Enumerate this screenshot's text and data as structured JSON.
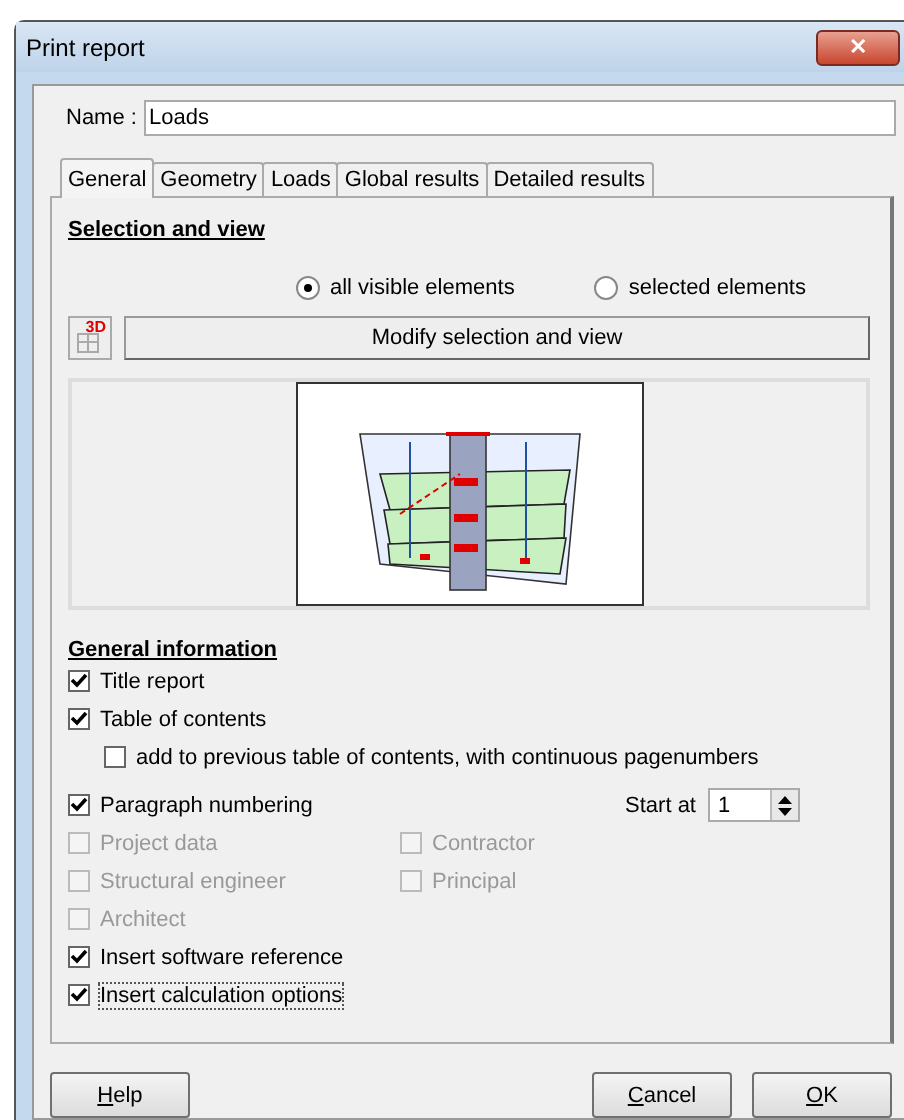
{
  "window": {
    "title": "Print report",
    "close": "✕"
  },
  "name_field": {
    "label": "Name :",
    "value": "Loads"
  },
  "tabs": [
    {
      "label": "General",
      "selected": true
    },
    {
      "label": "Geometry",
      "selected": false
    },
    {
      "label": "Loads",
      "selected": false
    },
    {
      "label": "Global results",
      "selected": false
    },
    {
      "label": "Detailed results",
      "selected": false
    }
  ],
  "selection": {
    "heading": "Selection and view",
    "radios": [
      {
        "label": "all visible elements",
        "selected": true
      },
      {
        "label": "selected elements",
        "selected": false
      }
    ],
    "icon_badge": "3D",
    "modify_button": "Modify selection and view"
  },
  "general": {
    "heading": "General information",
    "rows": [
      {
        "items": [
          {
            "label": "Title report",
            "checked": true,
            "disabled": false
          }
        ]
      },
      {
        "items": [
          {
            "label": "Table of contents",
            "checked": true,
            "disabled": false,
            "children": [
              {
                "label": "add to previous table of contents, with continuous pagenumbers",
                "checked": false,
                "disabled": false
              }
            ]
          }
        ]
      },
      {
        "items": [
          {
            "label": "Paragraph numbering",
            "checked": true,
            "disabled": false
          }
        ],
        "spinner": {
          "label": "Start at",
          "value": "1"
        }
      },
      {
        "items": [
          {
            "label": "Project data",
            "checked": false,
            "disabled": true
          },
          {
            "label": "Contractor",
            "checked": false,
            "disabled": true
          }
        ]
      },
      {
        "items": [
          {
            "label": "Structural engineer",
            "checked": false,
            "disabled": true
          },
          {
            "label": "Principal",
            "checked": false,
            "disabled": true
          }
        ]
      },
      {
        "items": [
          {
            "label": "Architect",
            "checked": false,
            "disabled": true
          }
        ]
      },
      {
        "items": [
          {
            "label": "Insert software reference",
            "checked": true,
            "disabled": false
          }
        ]
      },
      {
        "items": [
          {
            "label": "Insert calculation options",
            "checked": true,
            "disabled": false,
            "focused": true
          }
        ]
      }
    ]
  },
  "buttons": [
    {
      "label": "Help"
    },
    {
      "label": "Cancel"
    },
    {
      "label": "OK"
    }
  ]
}
